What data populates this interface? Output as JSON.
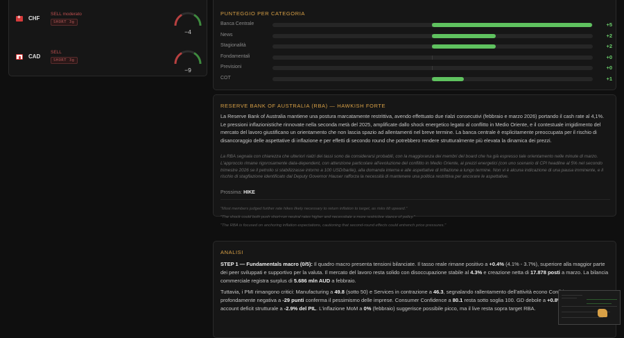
{
  "currencies": [
    {
      "code": "CHF",
      "signal": "SELL moderato",
      "badge": "SHORT 3g",
      "score": "−4",
      "level": -4
    },
    {
      "code": "CAD",
      "signal": "SELL",
      "badge": "SHORT 3g",
      "score": "−9",
      "level": -9
    }
  ],
  "score_card": {
    "title": "PUNTEGGIO PER CATEGORIA",
    "rows": [
      {
        "label": "Banca Centrale",
        "value": "+5",
        "fraction": 1.0
      },
      {
        "label": "News",
        "value": "+2",
        "fraction": 0.4
      },
      {
        "label": "Stagionalità",
        "value": "+2",
        "fraction": 0.4
      },
      {
        "label": "Fondamentali",
        "value": "+0",
        "fraction": 0.0
      },
      {
        "label": "Previsioni",
        "value": "+0",
        "fraction": 0.0
      },
      {
        "label": "COT",
        "value": "+1",
        "fraction": 0.2
      }
    ]
  },
  "rba": {
    "title": "RESERVE BANK OF AUSTRALIA (RBA) — HAWKISH FORTE",
    "body": "La Reserve Bank of Australia mantiene una postura marcatamente restrittiva, avendo effettuato due rialzi consecutivi (febbraio e marzo 2026) portando il cash rate al 4,1%. Le pressioni inflazionistiche rinnovate nella seconda metà del 2025, amplificate dallo shock energetico legato al conflitto in Medio Oriente, e il contestuale irrigidimento del mercato del lavoro giustificano un orientamento che non lascia spazio ad allentamenti nel breve termine. La banca centrale è esplicitamente preoccupata per il rischio di disancoraggio delle aspettative di inflazione e per effetti di secondo round che potrebbero rendere strutturalmente più elevata la dinamica dei prezzi.",
    "italic": "La RBA segnala con chiarezza che ulteriori rialzi dei tassi sono da considerarsi probabili, con la maggioranza dei membri del board che ha già espresso tale orientamento nelle minute di marzo. L'approccio rimane rigorosamente data-dependent, con attenzione particolare all'evoluzione del conflitto in Medio Oriente, ai prezzi energetici (con uno scenario di CPI headline al 5% nel secondo trimestre 2026 se il petrolio si stabilizzasse intorno a 100 USD/barile), alla domanda interna e alle aspettative di inflazione a lungo termine. Non vi è alcuna indicazione di una pausa imminente, e il rischio di stagflazione identificato dal Deputy Governor Hauser rafforza la necessità di mantenere una politica restrittiva per ancorare le aspettative.",
    "next_label": "Prossima:",
    "next_value": "HIKE",
    "quotes": [
      "\"Most members judged further rate hikes likely necessary to return inflation to target, as risks tilt upward.\"",
      "\"The shock could both push short-run neutral rates higher and necessitate a more restrictive stance of policy.\"",
      "\"The RBA is focused on anchoring inflation expectations, cautioning that second-round effects could entrench price pressures.\""
    ]
  },
  "analysis": {
    "title": "ANALISI",
    "p1": [
      {
        "t": "STEP 1 — Fundamentals macro (0/5):",
        "b": true
      },
      {
        "t": " Il quadro macro presenta tensioni bilanciate. Il tasso reale rimane positivo a ",
        "b": false
      },
      {
        "t": "+0.4%",
        "b": true
      },
      {
        "t": " (4.1% - 3.7%), superiore alla maggior parte dei peer sviluppati e supportivo per la valuta. Il mercato del lavoro resta solido con disoccupazione stabile al ",
        "b": false
      },
      {
        "t": "4.3%",
        "b": true
      },
      {
        "t": " e creazione netta di ",
        "b": false
      },
      {
        "t": "17.878 posti",
        "b": true
      },
      {
        "t": " a marzo. La bilancia commerciale registra surplus di ",
        "b": false
      },
      {
        "t": "5.686 mln AUD",
        "b": true
      },
      {
        "t": " a febbraio.",
        "b": false
      }
    ],
    "p2": [
      {
        "t": "Tuttavia, i PMI rimangono critici: Manufacturing a ",
        "b": false
      },
      {
        "t": "49.8",
        "b": true
      },
      {
        "t": " (sotto 50) e Services in contrazione a ",
        "b": false
      },
      {
        "t": "46.3",
        "b": true
      },
      {
        "t": ", segnalando rallentamento dell'attività econo",
        "b": false
      },
      {
        "t": " Confidence profondamente negativa a ",
        "b": false
      },
      {
        "t": "-29 punti",
        "b": true
      },
      {
        "t": " conferma il pessimismo delle imprese. Consumer Confidence a ",
        "b": false
      },
      {
        "t": "80.1",
        "b": true
      },
      {
        "t": " resta sotto soglia 100. GD",
        "b": false
      },
      {
        "t": " debole a ",
        "b": false
      },
      {
        "t": "+0.8%",
        "b": true
      },
      {
        "t": ", con current account deficit strutturale a ",
        "b": false
      },
      {
        "t": "-2.9% del PIL",
        "b": true
      },
      {
        "t": ". L'inflazione MoM a ",
        "b": false
      },
      {
        "t": "0%",
        "b": true
      },
      {
        "t": " (febbraio) suggerisce possibile picco, ma il live",
        "b": false
      },
      {
        "t": " resta sopra target RBA.",
        "b": false
      }
    ]
  },
  "colors": {
    "accent": "#d8a046",
    "positive": "#5fc25f",
    "negative": "#c05050",
    "background": "#0f0f0f",
    "card": "#161616"
  },
  "icons": [
    "swiss-flag-icon",
    "canadian-flag-icon",
    "gauge-icon"
  ]
}
